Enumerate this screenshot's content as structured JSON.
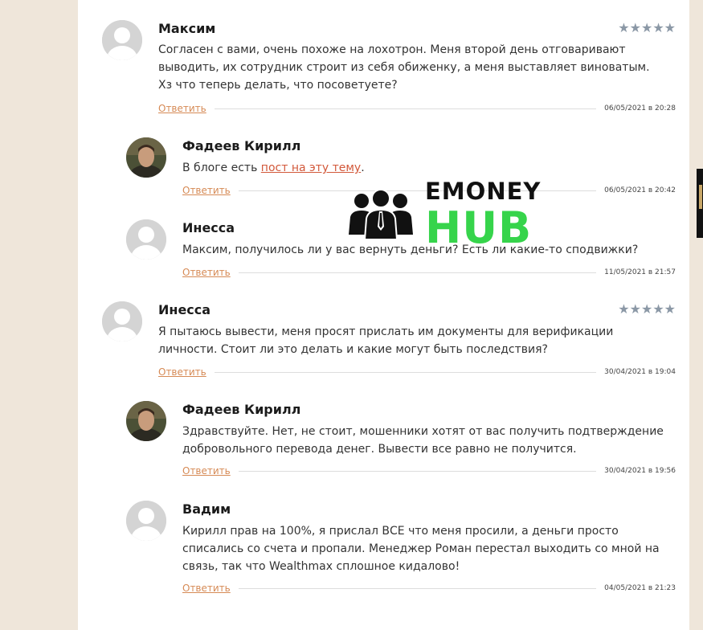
{
  "comments": [
    {
      "author": "Максим",
      "stars": "★★★★★",
      "text": "Согласен с вами, очень похоже на лохотрон. Меня второй день отговаривают выводить, их сотрудник строит из себя обиженку, а меня выставляет виноватым. Хз что теперь делать, что посоветуете?",
      "reply": "Ответить",
      "date": "06/05/2021 в 20:28"
    },
    {
      "author": "Фадеев Кирилл",
      "text_before": "В блоге есть ",
      "link": "пост на эту тему",
      "text_after": ".",
      "reply": "Ответить",
      "date": "06/05/2021 в 20:42"
    },
    {
      "author": "Инесса",
      "text": "Максим, получилось ли у вас вернуть деньги? Есть ли какие-то сподвижки?",
      "reply": "Ответить",
      "date": "11/05/2021 в 21:57"
    },
    {
      "author": "Инесса",
      "stars": "★★★★★",
      "text": "Я пытаюсь вывести, меня просят прислать им документы для верификации личности. Стоит ли это делать и какие могут быть последствия?",
      "reply": "Ответить",
      "date": "30/04/2021 в 19:04"
    },
    {
      "author": "Фадеев Кирилл",
      "text": "Здравствуйте. Нет, не стоит, мошенники хотят от вас получить подтверждение добровольного перевода денег. Вывести все равно не получится.",
      "reply": "Ответить",
      "date": "30/04/2021 в 19:56"
    },
    {
      "author": "Вадим",
      "text": "Кирилл прав на 100%, я прислал ВСЕ что меня просили, а деньги просто списались со счета и пропали. Менеджер Роман перестал выходить со мной на связь, так что Wealthmax сплошное кидалово!",
      "reply": "Ответить",
      "date": "04/05/2021 в 21:23"
    }
  ],
  "watermark": {
    "line1": "EMONEY",
    "line2": "HUB",
    "accent": "#36d44b"
  },
  "colors": {
    "link": "#d2583a",
    "reply": "#d68a55",
    "stars": "#8b98a6",
    "background": "#efe6da"
  }
}
